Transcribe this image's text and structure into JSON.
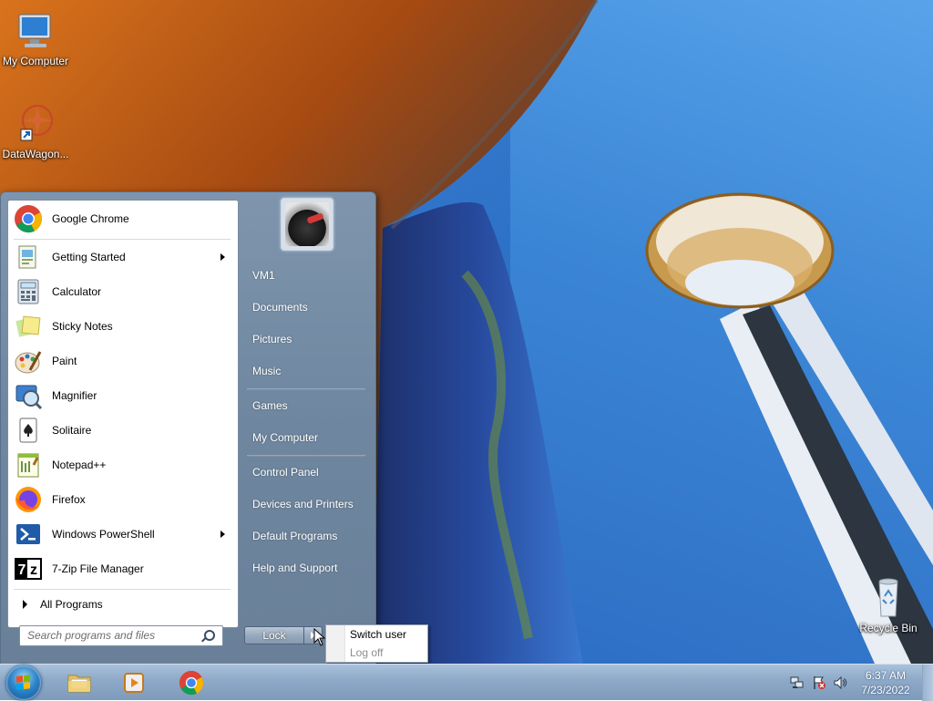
{
  "desktop": {
    "icons": [
      {
        "label": "My Computer",
        "icon": "computer-icon"
      },
      {
        "label": "DataWagon...",
        "icon": "datawagon-shortcut-icon"
      },
      {
        "label": "Recycle Bin",
        "icon": "recycle-bin-icon"
      }
    ]
  },
  "start_menu": {
    "programs": [
      {
        "label": "Google Chrome",
        "icon": "chrome-icon",
        "submenu": false
      },
      {
        "label": "Getting Started",
        "icon": "getting-started-icon",
        "submenu": true
      },
      {
        "label": "Calculator",
        "icon": "calculator-icon",
        "submenu": false
      },
      {
        "label": "Sticky Notes",
        "icon": "sticky-notes-icon",
        "submenu": false
      },
      {
        "label": "Paint",
        "icon": "paint-icon",
        "submenu": false
      },
      {
        "label": "Magnifier",
        "icon": "magnifier-icon",
        "submenu": false
      },
      {
        "label": "Solitaire",
        "icon": "solitaire-icon",
        "submenu": false
      },
      {
        "label": "Notepad++",
        "icon": "notepad-plus-plus-icon",
        "submenu": false
      },
      {
        "label": "Firefox",
        "icon": "firefox-icon",
        "submenu": false
      },
      {
        "label": "Windows PowerShell",
        "icon": "powershell-icon",
        "submenu": true
      },
      {
        "label": "7-Zip File Manager",
        "icon": "7zip-icon",
        "submenu": false
      }
    ],
    "all_programs_label": "All Programs",
    "search_placeholder": "Search programs and files",
    "right_items": [
      "VM1",
      "Documents",
      "Pictures",
      "Music",
      "Games",
      "My Computer",
      "Control Panel",
      "Devices and Printers",
      "Default Programs",
      "Help and Support"
    ],
    "lock_label": "Lock",
    "power_menu": {
      "switch_user": "Switch user",
      "log_off": "Log off"
    }
  },
  "taskbar": {
    "pinned": [
      "explorer-icon",
      "media-player-icon",
      "chrome-icon"
    ],
    "tray_icons": [
      "network-icon",
      "action-center-flag-icon",
      "volume-icon"
    ],
    "time": "6:37 AM",
    "date": "7/23/2022"
  },
  "colors": {
    "taskbar": "#90abc9",
    "start_menu_right": "#6e869f",
    "accent_blue": "#2d86c9"
  }
}
